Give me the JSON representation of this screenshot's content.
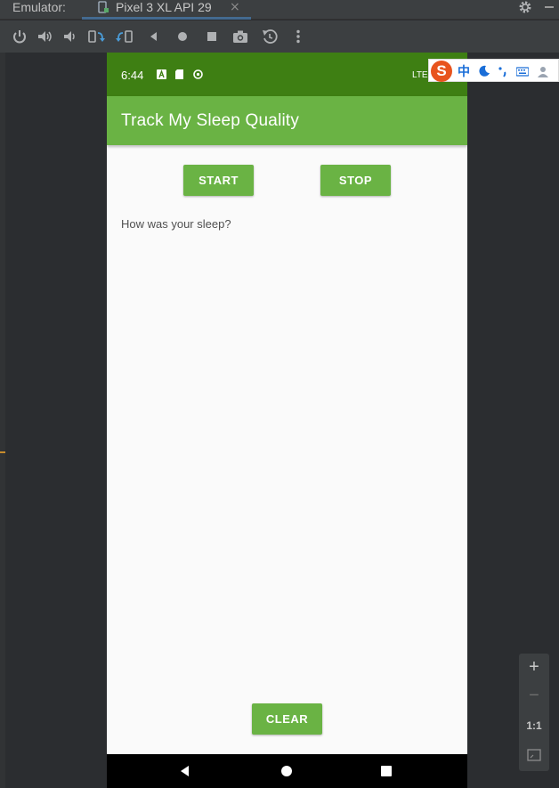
{
  "window": {
    "prefix": "Emulator:",
    "tab_label": "Pixel 3 XL API 29",
    "tab_close": "×"
  },
  "toolbar": {
    "items": [
      "power-icon",
      "volume-up-icon",
      "volume-down-icon",
      "rotate-left-icon",
      "rotate-right-icon",
      "back-icon",
      "home-icon",
      "overview-icon",
      "screenshot-icon",
      "snapshot-icon",
      "more-icon"
    ]
  },
  "status_bar": {
    "time": "6:44",
    "network": "LTE"
  },
  "app": {
    "title": "Track My Sleep Quality",
    "start_label": "START",
    "stop_label": "STOP",
    "question": "How was your sleep?",
    "clear_label": "CLEAR"
  },
  "ime": {
    "logo": "S",
    "lang": "中"
  },
  "zoom": {
    "zoom_in": "+",
    "zoom_out": "−",
    "one_to_one": "1:1"
  },
  "colors": {
    "status_bar": "#3e7f13",
    "app_bar": "#6ab344",
    "button": "#6ab344"
  }
}
